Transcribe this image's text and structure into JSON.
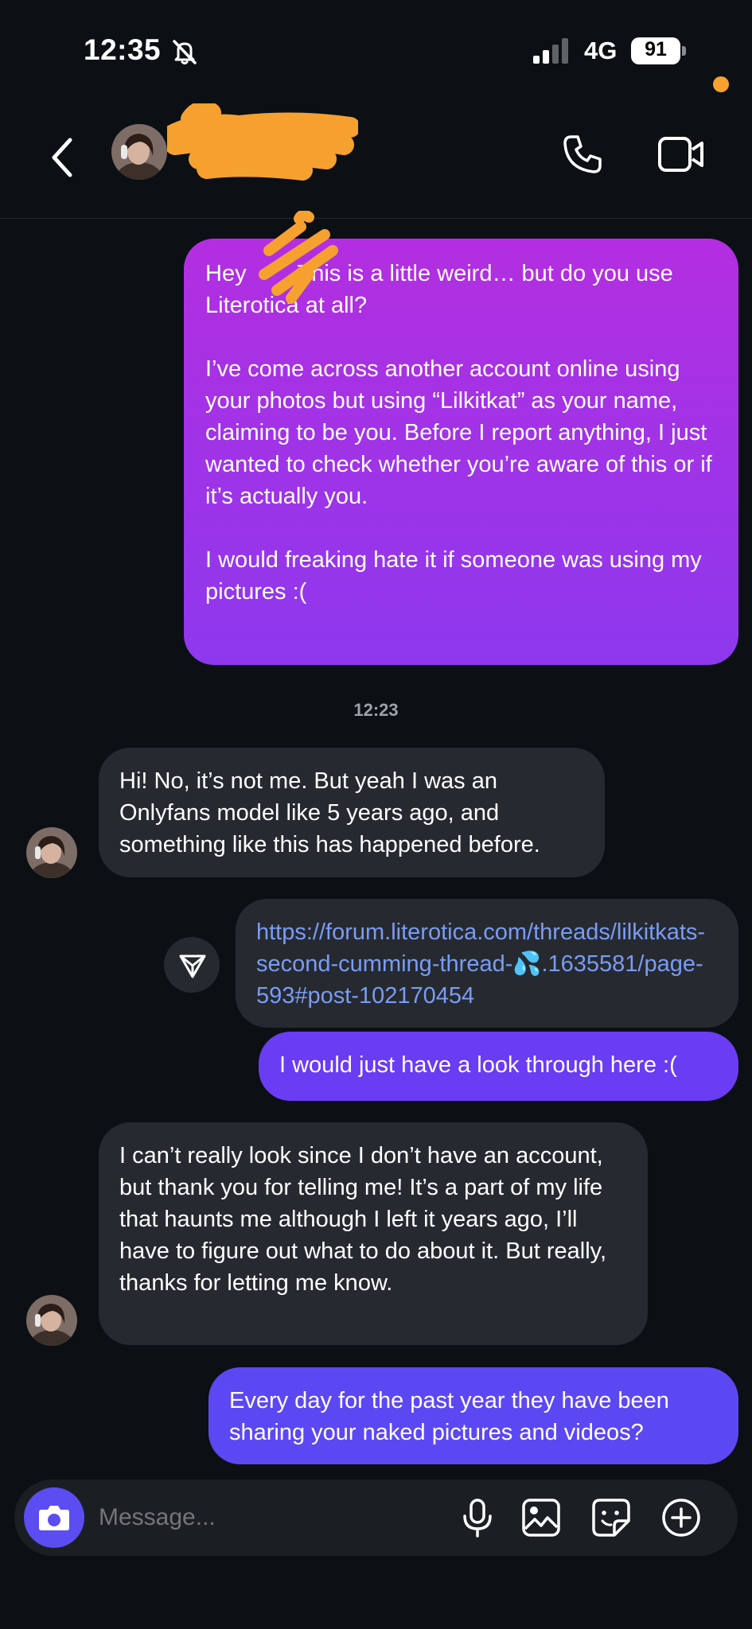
{
  "status_bar": {
    "time": "12:35",
    "network": "4G",
    "battery": "91"
  },
  "header": {
    "contact_name": ""
  },
  "messages": [
    {
      "direction": "outgoing",
      "text": "Hey        This is a little weird… but do you use Literotica at all?\n\nI’ve come across another account online using your photos but using “Lilkitkat” as your name, claiming to be you. Before I report anything, I just wanted to check whether you’re aware of this or if it’s actually you.\n\nI would freaking hate it if someone was using my pictures :("
    },
    {
      "direction": "incoming",
      "text": "Hi! No, it’s not me. But yeah I was an Onlyfans model like 5 years ago, and something like this has happened before."
    },
    {
      "direction": "outgoing",
      "text": "https://forum.literotica.com/threads/lilkitkats-second-cumming-thread-💦.1635581/page-593#post-102170454"
    },
    {
      "direction": "outgoing",
      "text": "I would just have a look through here :("
    },
    {
      "direction": "incoming",
      "text": "I can’t really look since I don’t have an account, but thank you for telling me! It’s a part of my life that haunts me although I left it years ago, I’ll have to figure out what to do about it. But really, thanks for letting me know."
    },
    {
      "direction": "outgoing",
      "text": "Every day for the past year they have been sharing your naked pictures and videos?"
    }
  ],
  "timestamp": "12:23",
  "composer": {
    "placeholder": "Message..."
  },
  "colors": {
    "background": "#0c1014",
    "incoming_bubble": "#262a30",
    "outgoing_top": "#b32ee0",
    "outgoing_bottom": "#5c48f2",
    "link": "#7a9cf4",
    "redaction": "#f6a12f"
  },
  "icons": [
    "bell-slash-icon",
    "signal-icon",
    "battery-icon",
    "back-chevron-icon",
    "phone-icon",
    "video-camera-icon",
    "share-icon",
    "camera-icon",
    "microphone-icon",
    "gallery-icon",
    "sticker-icon",
    "plus-icon"
  ]
}
